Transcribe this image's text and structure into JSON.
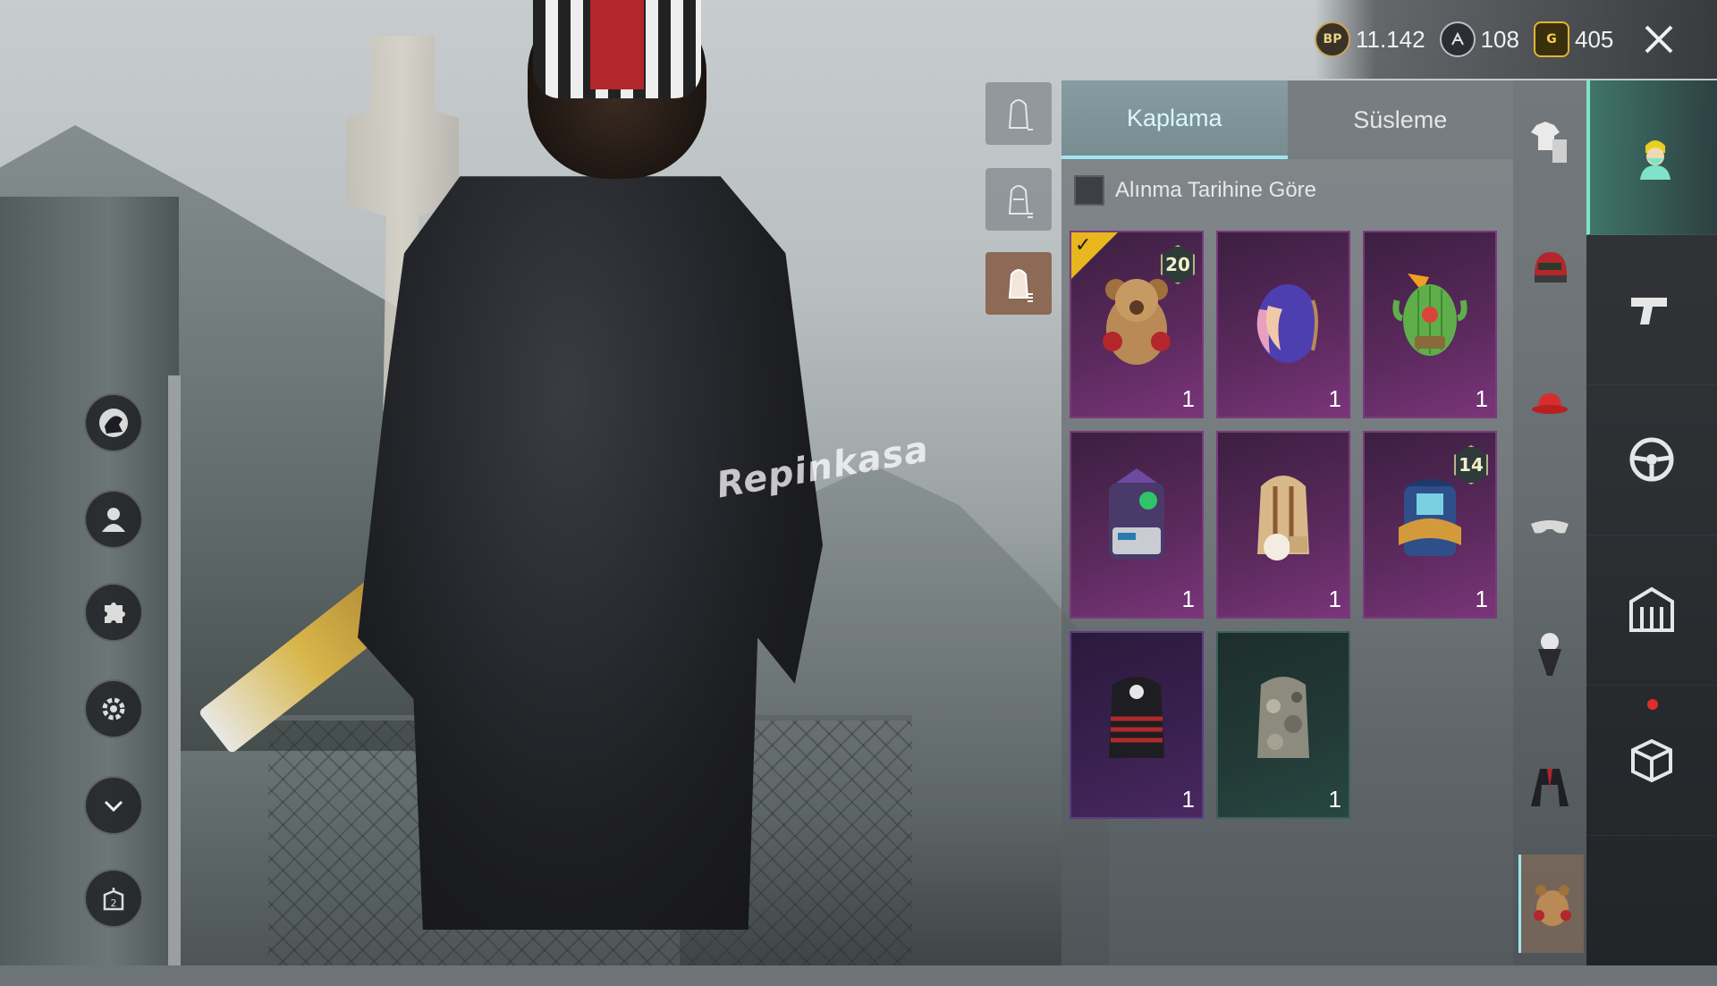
{
  "currency": {
    "bp": {
      "icon": "bp-coin-icon",
      "label": "BP",
      "value": "11.142"
    },
    "ag": {
      "icon": "ag-coin-icon",
      "value": "108"
    },
    "g": {
      "icon": "g-coin-icon",
      "label": "G",
      "value": "405"
    }
  },
  "watermark": "Repinkasa",
  "tabs": [
    {
      "label": "Kaplama",
      "active": true
    },
    {
      "label": "Süsleme",
      "active": false
    }
  ],
  "sort": {
    "label": "Alınma Tarihine Göre",
    "checked": false
  },
  "items": [
    {
      "name": "bear-backpack",
      "quantity": "1",
      "level": "20",
      "equipped": true,
      "rarity": "epic"
    },
    {
      "name": "feather-egg-backpack",
      "quantity": "1",
      "rarity": "epic"
    },
    {
      "name": "cactus-backpack",
      "quantity": "1",
      "rarity": "epic"
    },
    {
      "name": "mech-backpack",
      "quantity": "1",
      "rarity": "epic"
    },
    {
      "name": "beige-backpack",
      "quantity": "1",
      "rarity": "epic"
    },
    {
      "name": "ornate-backpack",
      "quantity": "1",
      "level": "14",
      "rarity": "epic"
    },
    {
      "name": "red-black-backpack",
      "quantity": "1",
      "rarity": "rare"
    },
    {
      "name": "camo-backpack",
      "quantity": "1",
      "rarity": "uncommon"
    }
  ],
  "left_menu": [
    "profile-icon",
    "user-icon",
    "puzzle-icon",
    "gear-icon",
    "chevron-down-icon",
    "outfit-slot-icon"
  ],
  "outfit_slot_badge": "2",
  "colors": {
    "accent": "#9fe6f2",
    "epic": "#7a3579",
    "rare": "#4a2760",
    "uncommon": "#284741",
    "equipped": "#e8b61e",
    "nav_active": "#7ee3c9"
  }
}
